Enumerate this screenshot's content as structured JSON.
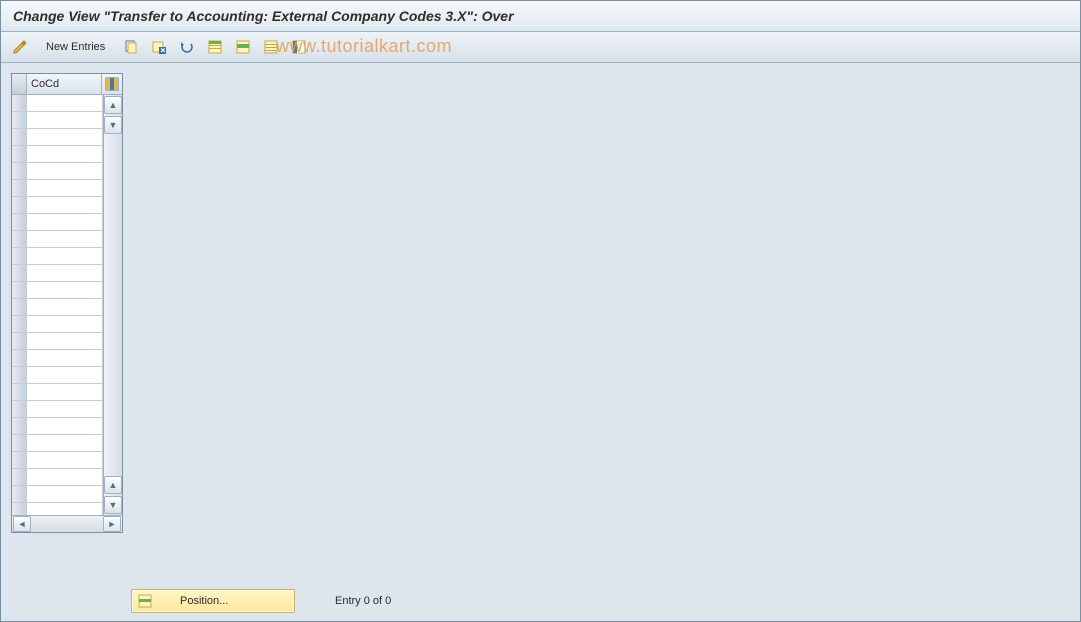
{
  "title": "Change View \"Transfer to Accounting: External Company Codes 3.X\": Over",
  "toolbar": {
    "new_entries_label": "New Entries"
  },
  "watermark": "www.tutorialkart.com",
  "table": {
    "column_header": "CoCd",
    "row_count": 25
  },
  "footer": {
    "position_label": "Position...",
    "entry_label": "Entry 0 of 0"
  }
}
